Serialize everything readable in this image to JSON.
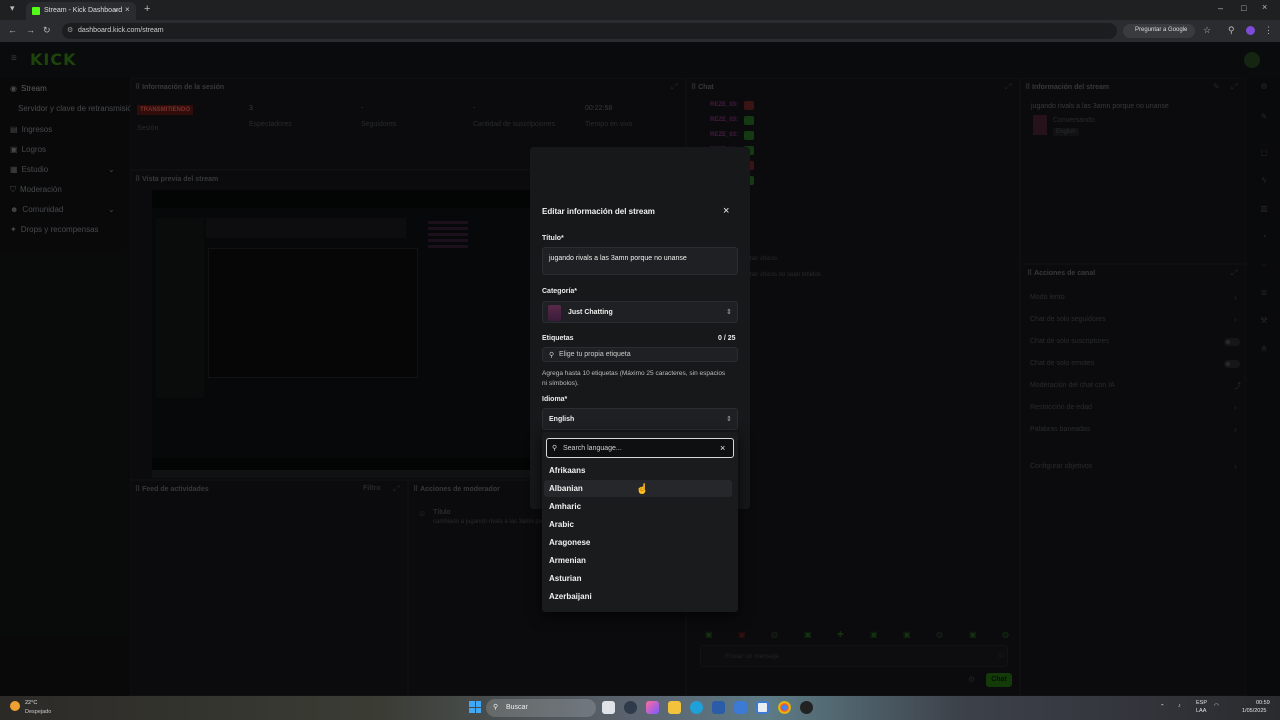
{
  "browser": {
    "tab_title": "Stream - Kick Dashboard",
    "url": "dashboard.kick.com/stream",
    "google_button": "Preguntar a Google"
  },
  "app": {
    "logo": "KICK",
    "sidebar": {
      "items": [
        {
          "label": "Stream"
        },
        {
          "label": "Servidor y clave de retransmisión"
        },
        {
          "label": "Ingresos"
        },
        {
          "label": "Logros"
        },
        {
          "label": "Estudio"
        },
        {
          "label": "Moderación"
        },
        {
          "label": "Comunidad"
        },
        {
          "label": "Drops y recompensas"
        }
      ]
    },
    "session": {
      "title": "Información de la sesión",
      "status": "TRANSMITIENDO",
      "status_sub": "Sesión",
      "viewers_value": "3",
      "viewers_label": "Espectadores",
      "followers_value": "-",
      "followers_label": "Seguidores",
      "subs_value": "-",
      "subs_label": "Cantidad de suscripciones",
      "time_value": "00:22:58",
      "time_label": "Tiempo en vivo"
    },
    "preview": {
      "title": "Vista previa del stream"
    },
    "activity": {
      "title": "Feed de actividades",
      "filter": "Filtro"
    },
    "mod_actions": {
      "title": "Acciones de moderador",
      "item_title": "Título",
      "item_text": "cambiado a jugando rivals a las 3amn porque no unanse"
    },
    "chat": {
      "title": "Chat",
      "username": "REZE_03:",
      "note_1": "tan chicos",
      "note_2": "tan chicos no sean timidos",
      "input_placeholder": "Enviar un mensaje",
      "send_button": "Chat"
    },
    "stream_info": {
      "title": "Información del stream",
      "stream_title": "jugando rivals a las 3amn porque no unanse",
      "category": "Conversando",
      "language": "English"
    },
    "channel_actions": {
      "title": "Acciones de canal",
      "items": [
        "Modo lento",
        "Chat de solo seguidores",
        "Chat de solo suscriptores",
        "Chat de solo emotes",
        "Moderación del chat con IA",
        "Restricción de edad",
        "Palabras baneadas",
        "Configurar objetivos"
      ]
    }
  },
  "modal": {
    "title": "Editar información del stream",
    "title_label": "Título*",
    "title_value": "jugando rivals a las 3amn porque no unanse",
    "category_label": "Categoría*",
    "category_value": "Just Chatting",
    "tags_label": "Etiquetas",
    "tags_count": "0 / 25",
    "tags_placeholder": "Elige tu propia etiqueta",
    "tags_help": "Agrega hasta 10 etiquetas (Máximo 25 caracteres, sin espacios ni símbolos).",
    "language_label": "Idioma*",
    "language_value": "English",
    "search_placeholder": "Search language...",
    "options": [
      "Afrikaans",
      "Albanian",
      "Amharic",
      "Arabic",
      "Aragonese",
      "Armenian",
      "Asturian",
      "Azerbaijani"
    ],
    "hovered_option": "Albanian"
  },
  "taskbar": {
    "weather_temp": "22°C",
    "weather_desc": "Despejado",
    "search": "Buscar",
    "lang": "ESP",
    "lang2": "LAA",
    "time": "00:59",
    "date": "1/05/2025"
  },
  "colors": {
    "kick_green": "#53fc18",
    "live_red": "#b94a40",
    "chat_user": "#6a2a63"
  }
}
